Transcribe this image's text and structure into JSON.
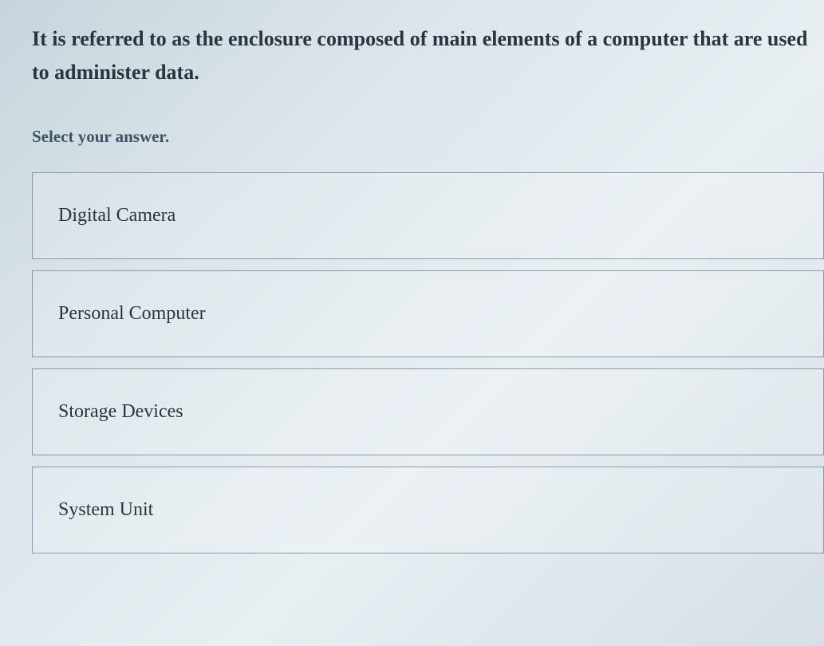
{
  "question": "It is referred to as the enclosure composed of main elements of a computer that are used to administer data.",
  "prompt": "Select your answer.",
  "options": [
    "Digital Camera",
    "Personal Computer",
    "Storage Devices",
    "System Unit"
  ]
}
